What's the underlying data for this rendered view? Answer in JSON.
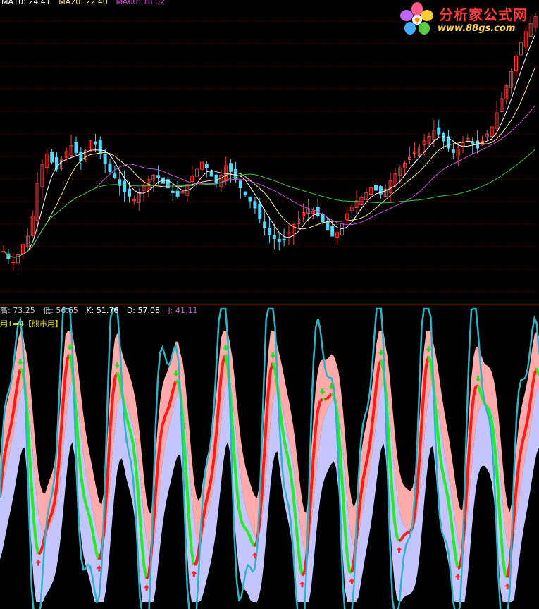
{
  "top_legend": {
    "ma_a": "MA10: 24.41",
    "ma_b": "MA20: 22.40",
    "ma_c": "MA60: 18.02"
  },
  "indicator_legend": {
    "high": "高: 73.25",
    "low": "低: 56.65",
    "k": "K: 51.76",
    "d": "D: 57.08",
    "j": "J: 41.11"
  },
  "mode_label": "用T=4【熊市用】",
  "logo": {
    "name": "分析家公式网",
    "url": "www.88gs.com"
  },
  "colors": {
    "background": "#000000",
    "grid": "#7a0000",
    "separator": "#c00000",
    "candle_up": "#ff3b3b",
    "candle_down": "#54d8ff",
    "ma_short": "#ffffff",
    "ma_mid": "#ffe68a",
    "ma_long": "#d04ad8",
    "ma_longest": "#40c040",
    "band_upper": "#ffaaaa",
    "band_lower": "#c4c4ff",
    "k_line": "#ff1a1a",
    "d_line": "#22ee22",
    "j_line": "#2ab4c8",
    "arrow_down": "#22dd22",
    "arrow_up": "#ff2a2a",
    "legend_k": "#ffffff",
    "legend_d": "#ffffff",
    "legend_j": "#d04ad8",
    "legend_hl": "#c8c8c8"
  },
  "chart_data": [
    {
      "type": "candlestick",
      "panel": "price",
      "ylim": [
        8,
        32
      ],
      "series": [
        {
          "name": "MA10",
          "role": "ma_short"
        },
        {
          "name": "MA20",
          "role": "ma_mid"
        },
        {
          "name": "MA60",
          "role": "ma_long"
        }
      ],
      "close": [
        11.8,
        11.2,
        10.9,
        11.5,
        12.4,
        13.1,
        14.8,
        17.6,
        19.2,
        20.1,
        19.4,
        18.8,
        19.6,
        20.3,
        20.8,
        20.2,
        19.5,
        20.4,
        21.2,
        20.9,
        20.1,
        19.3,
        18.6,
        18.1,
        17.4,
        16.9,
        16.5,
        16.2,
        16.8,
        17.4,
        17.9,
        18.3,
        18.1,
        17.6,
        17.2,
        16.8,
        16.5,
        16.9,
        17.5,
        18.2,
        18.8,
        19.4,
        18.9,
        18.2,
        17.6,
        18.3,
        19.1,
        18.6,
        17.9,
        17.2,
        16.6,
        16.1,
        15.5,
        14.6,
        13.8,
        13.2,
        12.9,
        12.6,
        12.8,
        13.4,
        14.1,
        14.6,
        15.1,
        15.4,
        15.2,
        14.8,
        14.3,
        13.6,
        13.1,
        13.4,
        14.2,
        15.0,
        15.6,
        16.1,
        16.4,
        16.8,
        17.2,
        17.0,
        16.7,
        17.1,
        17.8,
        18.4,
        18.9,
        19.3,
        19.8,
        20.3,
        20.7,
        21.2,
        21.6,
        22.1,
        21.8,
        21.2,
        20.6,
        20.2,
        20.5,
        21.1,
        21.4,
        21.0,
        20.6,
        21.2,
        21.8,
        22.4,
        23.6,
        24.8,
        25.9,
        27.1,
        28.4,
        29.6,
        30.5,
        31.2,
        31.8
      ]
    },
    {
      "type": "line",
      "panel": "indicator",
      "ylim": [
        0,
        100
      ],
      "series": [
        {
          "name": "K",
          "role": "k_line"
        },
        {
          "name": "D",
          "role": "d_line"
        },
        {
          "name": "J",
          "role": "j_line"
        }
      ]
    }
  ]
}
